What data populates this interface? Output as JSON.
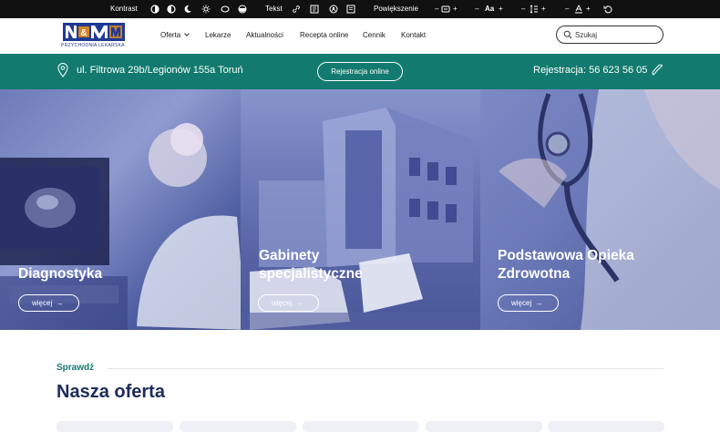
{
  "accessibility_bar": {
    "contrast_label": "Kontrast",
    "text_label": "Tekst",
    "zoom_label": "Powiększenie",
    "zoom_controls": [
      {
        "minus": "–",
        "icon": "page-zoom-icon",
        "plus": "+"
      },
      {
        "minus": "–",
        "text": "Aa",
        "plus": "+"
      },
      {
        "minus": "–",
        "icon": "line-height-icon",
        "plus": "+"
      },
      {
        "minus": "–",
        "icon": "letter-spacing-icon",
        "plus": "+"
      }
    ],
    "reset_icon": "reset-icon"
  },
  "header": {
    "logo_text": "PRZYCHODNIA LEKARSKA",
    "nav": {
      "oferta": "Oferta",
      "lekarze": "Lekarze",
      "aktualnosci": "Aktualności",
      "recepta": "Recepta online",
      "cennik": "Cennik",
      "kontakt": "Kontakt"
    },
    "search_placeholder": "Szukaj"
  },
  "info_bar": {
    "address": "ul. Filtrowa 29b/Legionów 155a Toruń",
    "register_button": "Rejestracja online",
    "phone": "Rejestracja: 56 623 56 05"
  },
  "hero": {
    "panels": [
      {
        "title": "Diagnostyka",
        "button": "więcej"
      },
      {
        "title_line1": "Gabinety",
        "title_line2": "specjalistyczne",
        "button": "więcej"
      },
      {
        "title_line1": "Podstawowa Opieka",
        "title_line2": "Zdrowotna",
        "button": "więcej"
      }
    ]
  },
  "offer": {
    "eyebrow": "Sprawdź",
    "title": "Nasza oferta"
  },
  "colors": {
    "teal": "#127a6e",
    "navy": "#1c2b5e",
    "overlay": "#5b67ad",
    "topbar": "#111111"
  }
}
